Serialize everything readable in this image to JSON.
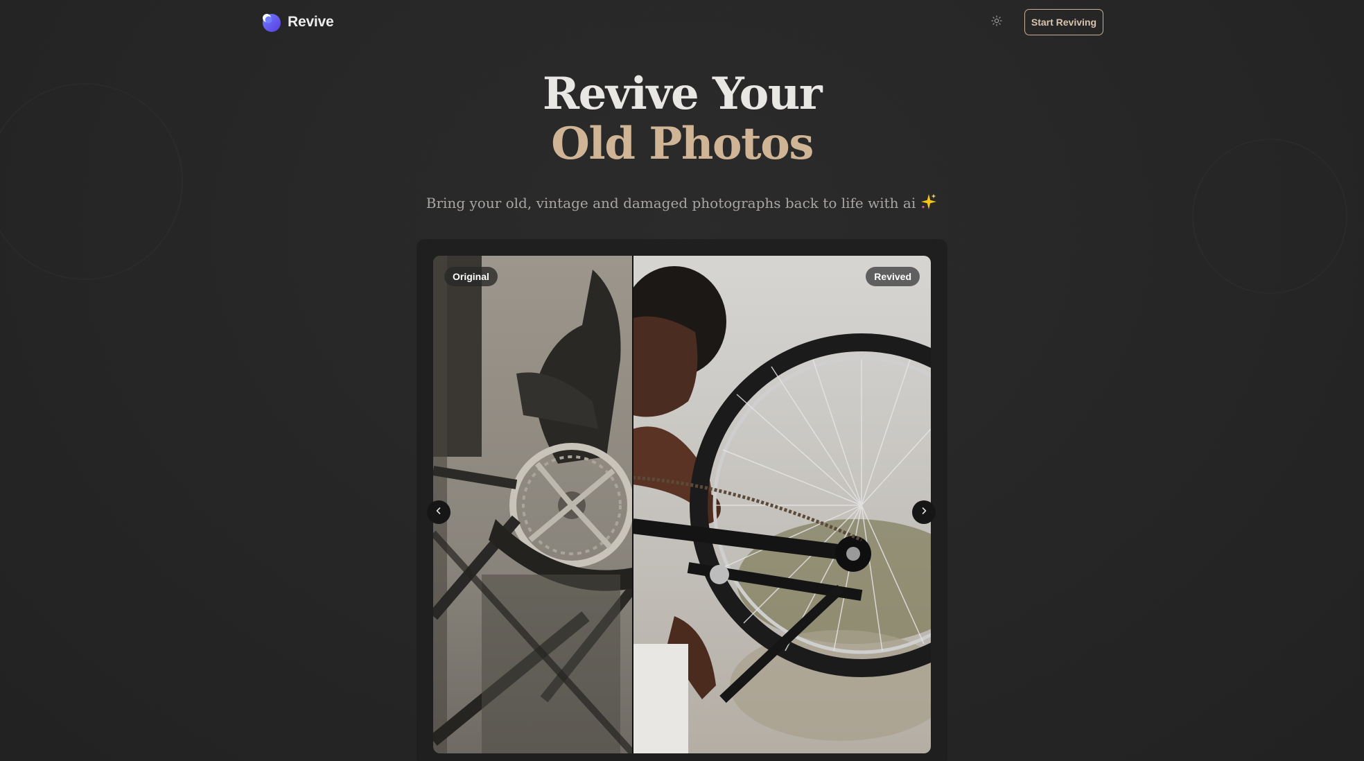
{
  "header": {
    "brand_name": "Revive",
    "logo_icon": "crescent-moon-logo",
    "theme_toggle_icon": "sun-icon",
    "cta_label": "Start Reviving"
  },
  "hero": {
    "title_line1": "Revive Your",
    "title_line2": "Old Photos",
    "subtitle": "Bring your old, vintage and damaged photographs back to life with ai",
    "subtitle_icon": "sparkles-icon"
  },
  "comparison": {
    "before_label": "Original",
    "after_label": "Revived",
    "prev_icon": "chevron-left-icon",
    "next_icon": "chevron-right-icon",
    "slider_position": 0.4
  },
  "colors": {
    "background": "#262626",
    "accent": "#cfb596",
    "card": "#1f1f1f"
  }
}
